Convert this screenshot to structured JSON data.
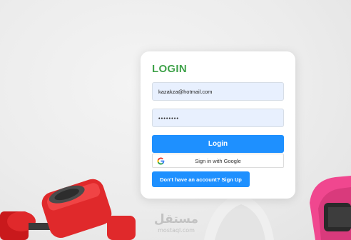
{
  "login_card": {
    "title": "LOGIN",
    "email_value": "kazakza@hotmail.com",
    "password_value": "••••••••",
    "login_button": "Login",
    "google_button": "Sign in with Google",
    "signup_button": "Don't have an account? Sign Up"
  },
  "watermark": {
    "main": "مستقل",
    "sub": "mostaql.com"
  },
  "colors": {
    "title_green": "#3fa24a",
    "primary_blue": "#1e90ff",
    "input_bg": "#e8f0fe",
    "dumbbell_red": "#e0292b",
    "sneaker_pink": "#f0478f"
  },
  "icons": [
    "google-icon"
  ]
}
